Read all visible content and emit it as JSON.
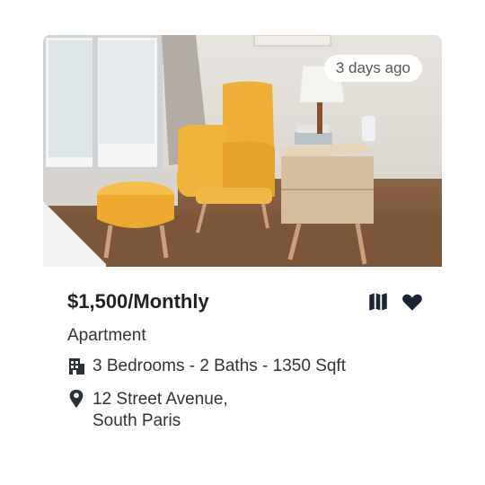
{
  "listing": {
    "time_posted": "3 days ago",
    "price": "$1,500/Monthly",
    "type": "Apartment",
    "specs": "3 Bedrooms - 2 Baths - 1350 Sqft",
    "address_line1": "12 Street Avenue,",
    "address_line2": "South Paris"
  },
  "icons": {
    "map": "map-icon",
    "favorite": "heart-icon",
    "building": "building-icon",
    "location": "location-pin-icon"
  },
  "colors": {
    "text_dark": "#222222",
    "icon_dark": "#1c2433",
    "badge_bg": "#ffffff"
  }
}
